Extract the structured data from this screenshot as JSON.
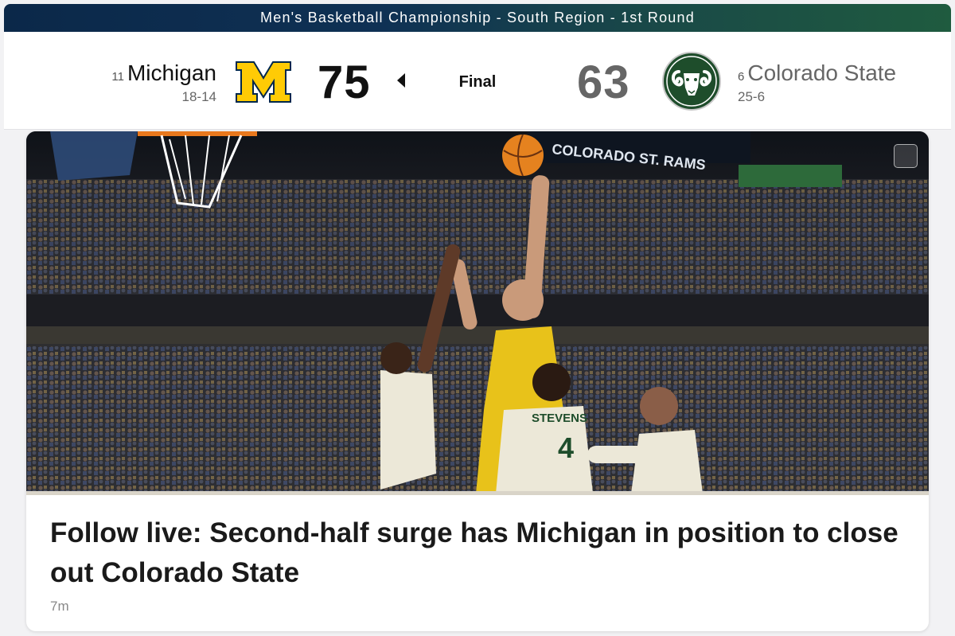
{
  "banner": {
    "title": "Men's Basketball Championship - South Region - 1st Round"
  },
  "game": {
    "status": "Final",
    "home": {
      "seed": "11",
      "name": "Michigan",
      "record": "18-14",
      "score": "75",
      "logo": "michigan-block-m",
      "color": "#FFCB05",
      "winner": true
    },
    "away": {
      "seed": "6",
      "name": "Colorado State",
      "record": "25-6",
      "score": "63",
      "logo": "colorado-state-ram",
      "color": "#1E4D2B",
      "winner": false
    }
  },
  "article": {
    "image_icon": "image-gallery-icon",
    "scene_text": {
      "arena_sign": "COLORADO ST. RAMS",
      "jersey_name": "STEVENS",
      "jersey_number": "4"
    },
    "headline": "Follow live: Second-half surge has Michigan in position to close out Colorado State",
    "timestamp": "7m"
  }
}
